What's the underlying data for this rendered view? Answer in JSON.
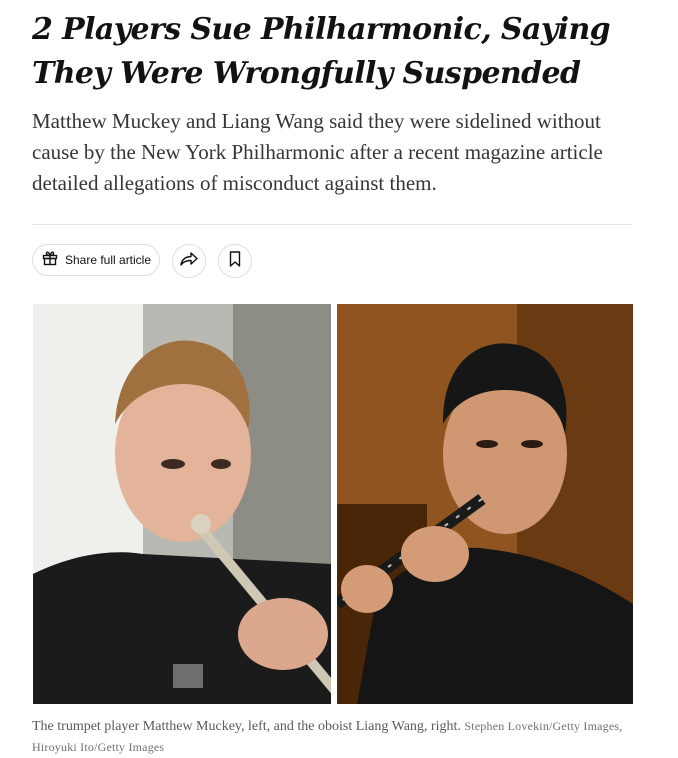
{
  "article": {
    "headline": "2 Players Sue Philharmonic, Saying They Were Wrongfully Suspended",
    "summary": "Matthew Muckey and Liang Wang said they were sidelined without cause by the New York Philharmonic after a recent magazine article detailed allegations of misconduct against them."
  },
  "share_bar": {
    "share_label": "Share full article",
    "share_icon": "gift-icon",
    "forward_icon": "share-arrow-icon",
    "save_icon": "bookmark-icon"
  },
  "media": {
    "left_photo": "trumpet-player-photo",
    "right_photo": "oboist-photo",
    "caption": "The trumpet player Matthew Muckey, left, and the oboist Liang Wang, right.",
    "credit": "Stephen Lovekin/Getty Images, Hiroyuki Ito/Getty Images"
  }
}
